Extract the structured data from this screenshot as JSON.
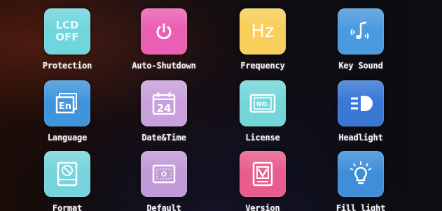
{
  "colors": {
    "teal": "#6fd6dd",
    "pink": "#ea5fb4",
    "yellow": "#f7cf5a",
    "blue": "#3f8fd8",
    "lavender": "#c49ad9",
    "rose": "#e85d8e",
    "label": "#f4f4f6"
  },
  "menu": {
    "items": [
      {
        "label": "Protection",
        "icon": "lcd-off-icon",
        "icon_text": "LCD OFF"
      },
      {
        "label": "Auto-Shutdown",
        "icon": "power-icon"
      },
      {
        "label": "Frequency",
        "icon": "hz-icon",
        "icon_text": "Hz"
      },
      {
        "label": "Key Sound",
        "icon": "music-note-icon"
      },
      {
        "label": "Language",
        "icon": "language-icon",
        "icon_text": "En"
      },
      {
        "label": "Date&Time",
        "icon": "calendar-icon",
        "icon_text": "24"
      },
      {
        "label": "License",
        "icon": "license-icon",
        "icon_text": "NO."
      },
      {
        "label": "Headlight",
        "icon": "headlight-icon"
      },
      {
        "label": "Format",
        "icon": "format-icon"
      },
      {
        "label": "Default",
        "icon": "default-icon"
      },
      {
        "label": "Version",
        "icon": "version-icon"
      },
      {
        "label": "Fill light",
        "icon": "fill-light-icon"
      }
    ]
  }
}
